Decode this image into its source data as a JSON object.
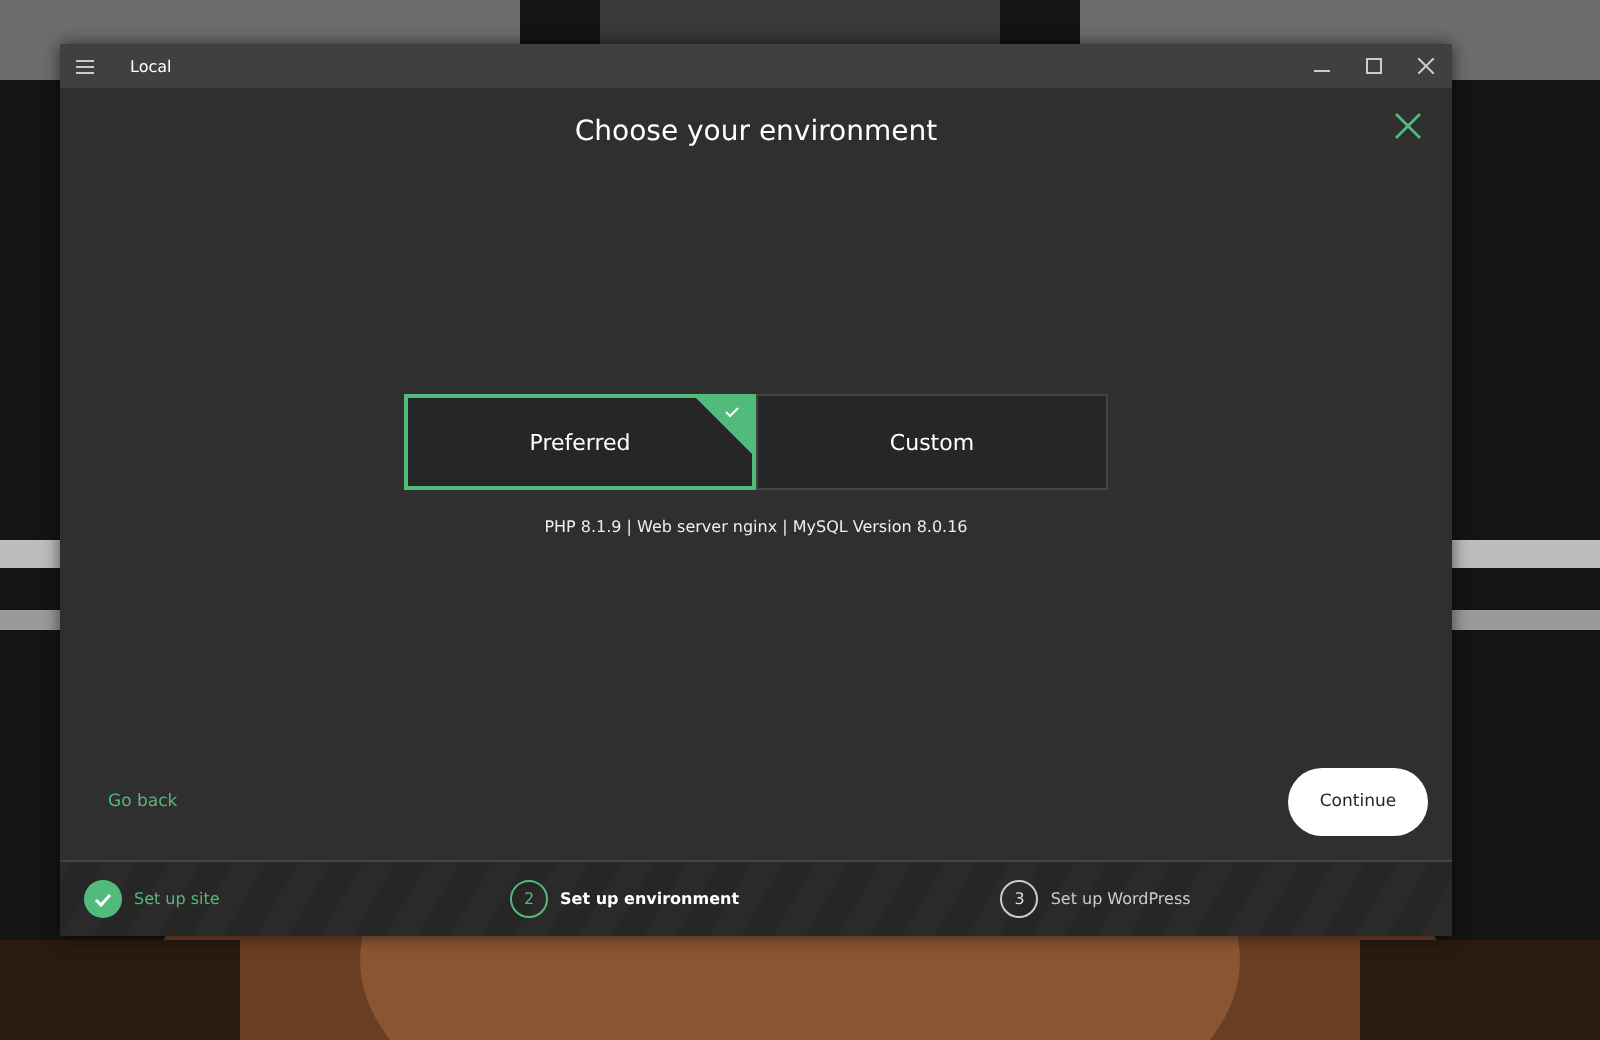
{
  "window": {
    "title": "Local"
  },
  "heading": "Choose your environment",
  "options": [
    {
      "label": "Preferred",
      "selected": true
    },
    {
      "label": "Custom",
      "selected": false
    }
  ],
  "summary": "PHP 8.1.9 | Web server nginx | MySQL Version 8.0.16",
  "go_back": "Go back",
  "continue": "Continue",
  "steps": [
    {
      "completed": true,
      "selected": false,
      "label": "Set up site"
    },
    {
      "completed": false,
      "selected": true,
      "number": "2",
      "label": "Set up environment"
    },
    {
      "completed": false,
      "selected": false,
      "number": "3",
      "label": "Set up WordPress"
    }
  ]
}
